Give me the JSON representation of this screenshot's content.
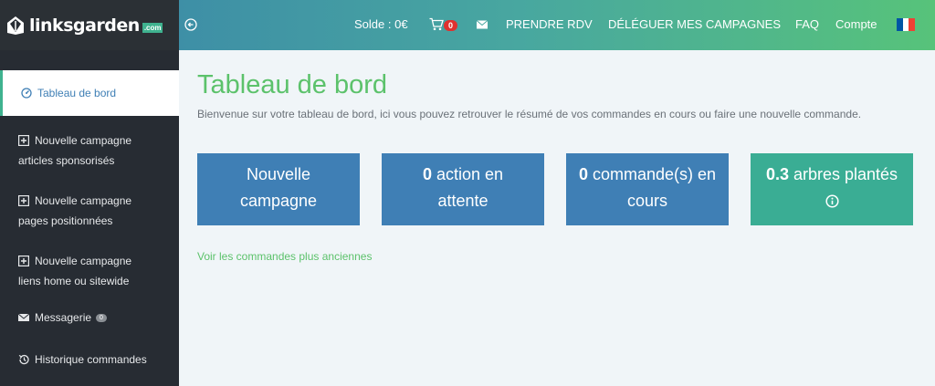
{
  "brand": {
    "name": "linksgarden",
    "badge": ".com"
  },
  "header": {
    "balance": "Solde : 0€",
    "cart_count": "0",
    "appointment": "PRENDRE RDV",
    "delegate": "DÉLÉGUER MES CAMPAGNES",
    "faq": "FAQ",
    "account": "Compte",
    "flag_colors": [
      "#0055a4",
      "#ffffff",
      "#ef4135"
    ]
  },
  "sidebar": {
    "items": [
      {
        "label": "Tableau de bord",
        "icon": "dashboard-icon"
      },
      {
        "label": "Nouvelle campagne",
        "sub": "articles sponsorisés",
        "icon": "plus-square-icon"
      },
      {
        "label": "Nouvelle campagne",
        "sub": "pages positionnées",
        "icon": "plus-square-icon"
      },
      {
        "label": "Nouvelle campagne",
        "sub": "liens home ou sitewide",
        "icon": "plus-square-icon"
      },
      {
        "label": "Messagerie",
        "badge": "0",
        "icon": "envelope-icon"
      },
      {
        "label": "Historique commandes",
        "icon": "history-icon"
      }
    ]
  },
  "main": {
    "title": "Tableau de bord",
    "description": "Bienvenue sur votre tableau de bord, ici vous pouvez retrouver le résumé de vos commandes en cours ou faire une nouvelle commande.",
    "cards": [
      {
        "line1": "Nouvelle",
        "line2": "campagne"
      },
      {
        "value": "0",
        "line1": " action en",
        "line2": "attente"
      },
      {
        "value": "0",
        "line1": " commande(s) en",
        "line2": "cours"
      },
      {
        "value": "0.3",
        "line1": " arbres plantés",
        "icon": "info-icon"
      }
    ],
    "old_orders_link": "Voir les commandes plus anciennes"
  },
  "colors": {
    "primary": "#3f7fb5",
    "accent_green": "#5cc26b",
    "teal": "#3aad94",
    "sidebar": "#272c33",
    "cart_badge": "#e0312f"
  }
}
